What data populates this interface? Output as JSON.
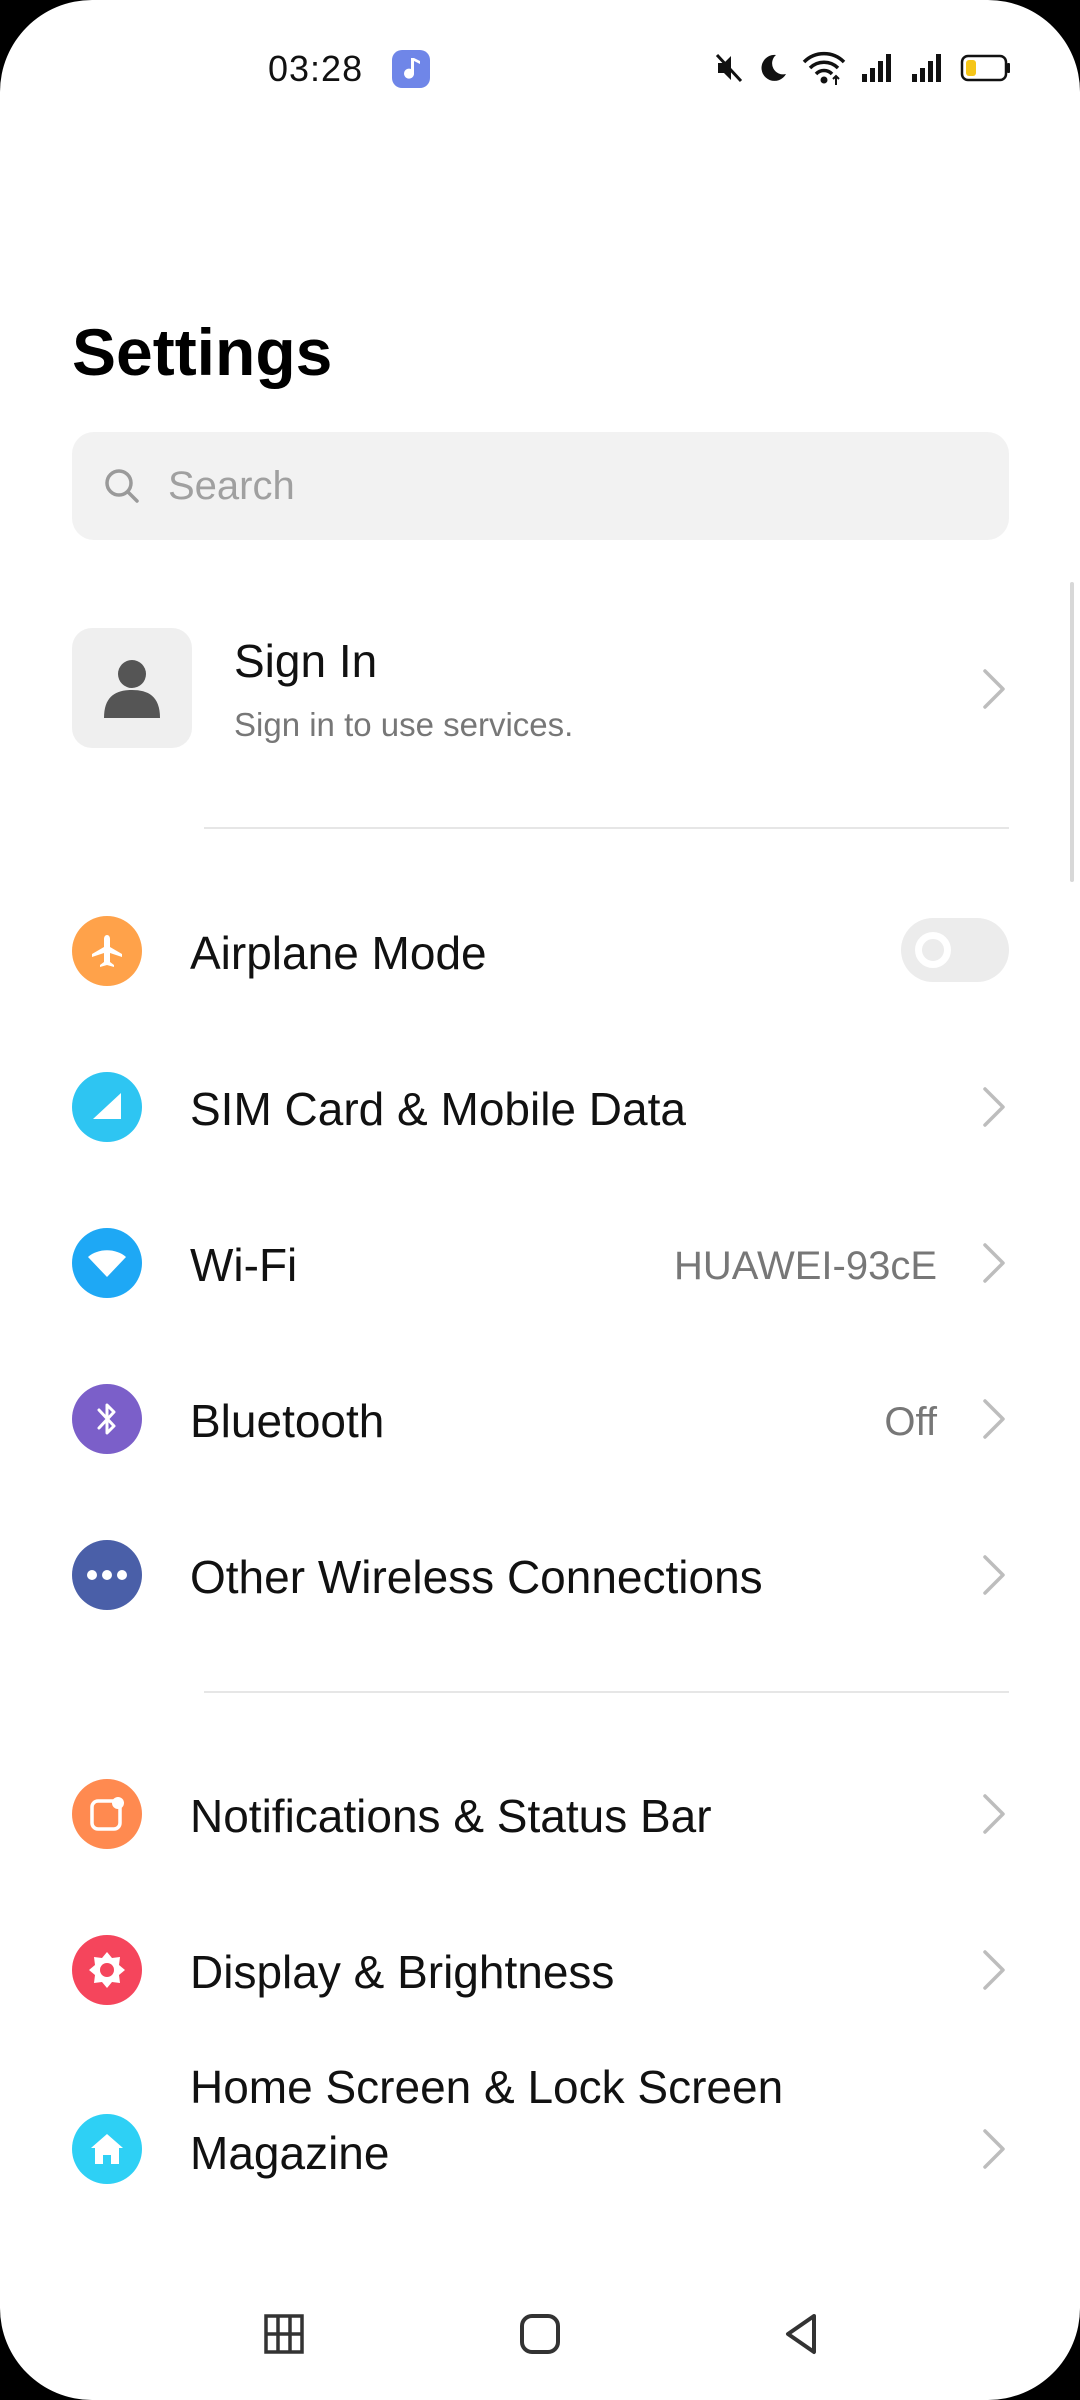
{
  "status_bar": {
    "time": "03:28",
    "icons": [
      "music-note-icon",
      "mute-icon",
      "do-not-disturb-moon-icon",
      "wifi-icon",
      "signal-1-icon",
      "signal-2-icon",
      "battery-icon"
    ]
  },
  "page": {
    "title": "Settings"
  },
  "search": {
    "placeholder": "Search",
    "value": ""
  },
  "account": {
    "title": "Sign In",
    "subtitle": "Sign in to use services."
  },
  "settings_groups": [
    {
      "items": [
        {
          "label": "Airplane Mode",
          "icon": "airplane-icon",
          "color": "#FFA24A",
          "control": "toggle",
          "toggle_on": false
        },
        {
          "label": "SIM Card & Mobile Data",
          "icon": "sim-signal-icon",
          "color": "#2EC5F2",
          "control": "chevron"
        },
        {
          "label": "Wi-Fi",
          "icon": "wifi-icon",
          "color": "#1EA8F5",
          "value": "HUAWEI-93cE",
          "control": "chevron"
        },
        {
          "label": "Bluetooth",
          "icon": "bluetooth-icon",
          "color": "#7B5FC9",
          "value": "Off",
          "control": "chevron"
        },
        {
          "label": "Other Wireless Connections",
          "icon": "more-dots-icon",
          "color": "#4A5FA8",
          "control": "chevron"
        }
      ]
    },
    {
      "items": [
        {
          "label": "Notifications & Status Bar",
          "icon": "notification-icon",
          "color": "#FF8A50",
          "control": "chevron"
        },
        {
          "label": "Display & Brightness",
          "icon": "brightness-icon",
          "color": "#F5455C",
          "control": "chevron"
        },
        {
          "label": "Home Screen & Lock Screen Magazine",
          "icon": "home-icon",
          "color": "#2ED0F5",
          "control": "chevron"
        }
      ]
    }
  ],
  "navigation": {
    "buttons": [
      "recent-apps-button",
      "home-button",
      "back-button"
    ]
  }
}
